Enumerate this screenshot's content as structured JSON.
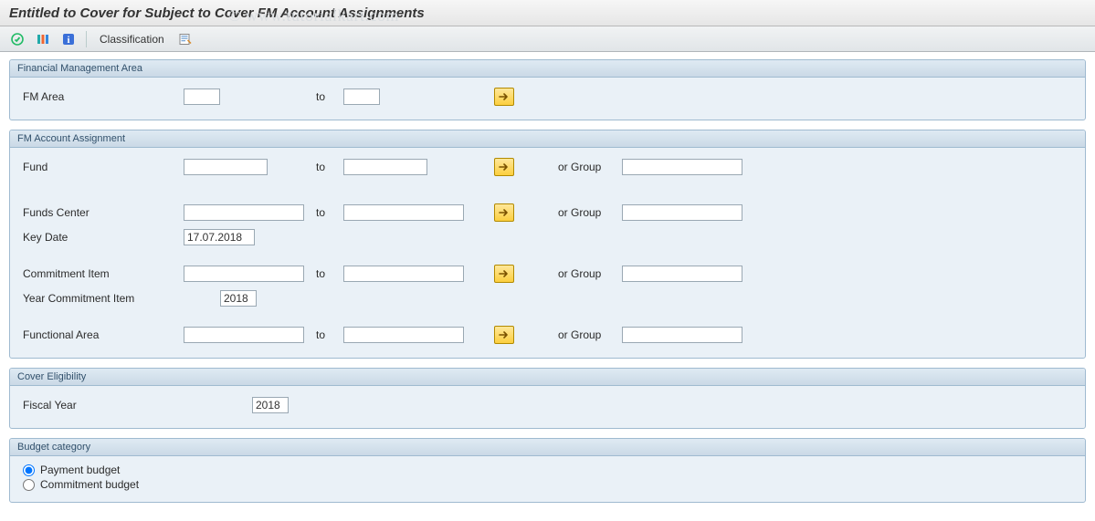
{
  "header": {
    "title": "Entitled to Cover for Subject to Cover FM Account Assignments"
  },
  "toolbar": {
    "classification": "Classification"
  },
  "watermark": "© www.tutorialkart.com",
  "groups": {
    "fma": {
      "title": "Financial Management Area",
      "fm_area_label": "FM Area",
      "to": "to",
      "fm_area_from": "",
      "fm_area_to": ""
    },
    "acct": {
      "title": "FM Account Assignment",
      "to": "to",
      "or_group": "or Group",
      "fund_label": "Fund",
      "fund_from": "",
      "fund_to": "",
      "fund_group": "",
      "fc_label": "Funds Center",
      "fc_from": "",
      "fc_to": "",
      "fc_group": "",
      "keydate_label": "Key Date",
      "keydate": "17.07.2018",
      "ci_label": "Commitment Item",
      "ci_from": "",
      "ci_to": "",
      "ci_group": "",
      "yci_label": "Year Commitment Item",
      "yci": "2018",
      "fa_label": "Functional Area",
      "fa_from": "",
      "fa_to": "",
      "fa_group": ""
    },
    "cover": {
      "title": "Cover Eligibility",
      "fy_label": "Fiscal Year",
      "fy": "2018"
    },
    "budget": {
      "title": "Budget category",
      "payment": "Payment budget",
      "commitment": "Commitment budget"
    }
  }
}
